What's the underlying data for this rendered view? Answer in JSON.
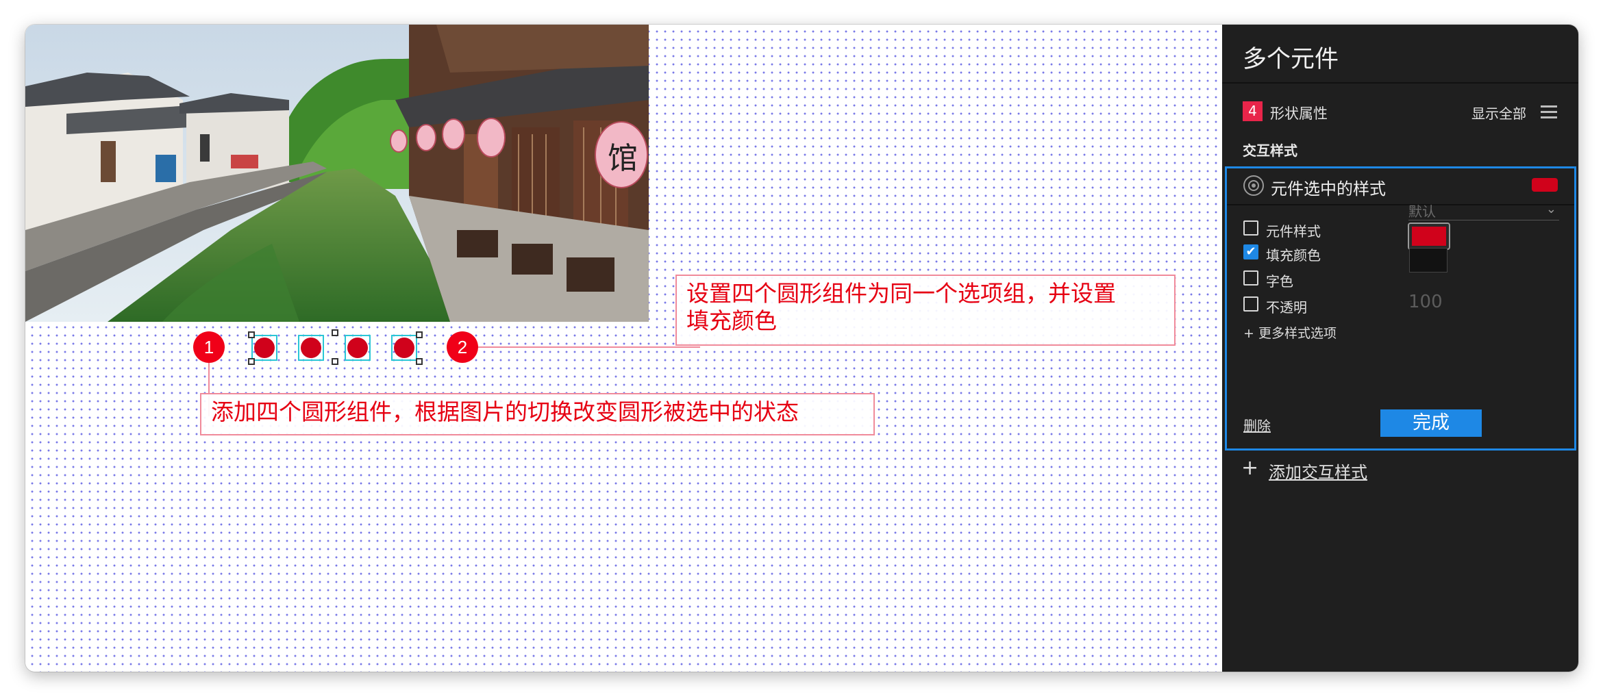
{
  "annotations": {
    "marker1": "1",
    "marker2": "2",
    "note1": "添加四个圆形组件，根据图片的切换改变圆形被选中的状态",
    "note2_line1": "设置四个圆形组件为同一个选项组，并设置",
    "note2_line2": "填充颜色"
  },
  "photo": {
    "lantern_text": "馆"
  },
  "panel": {
    "title": "多个元件",
    "section_badge": "4",
    "section_label": "形状属性",
    "show_all": "显示全部",
    "interaction_heading": "交互样式",
    "selected_style_label": "元件选中的样式",
    "rows": [
      {
        "label": "元件样式",
        "checked": false,
        "value": "默认"
      },
      {
        "label": "填充颜色",
        "checked": true
      },
      {
        "label": "字色",
        "checked": false
      },
      {
        "label": "不透明",
        "checked": false,
        "value": "100"
      }
    ],
    "more_options": "+ 更多样式选项",
    "delete": "删除",
    "done": "完成",
    "add_interaction": "添加交互样式"
  },
  "colors": {
    "selected_fill": "#d0021b",
    "text_color": "#121212",
    "accent": "#1e88e5",
    "annotation_red": "#e60012"
  }
}
